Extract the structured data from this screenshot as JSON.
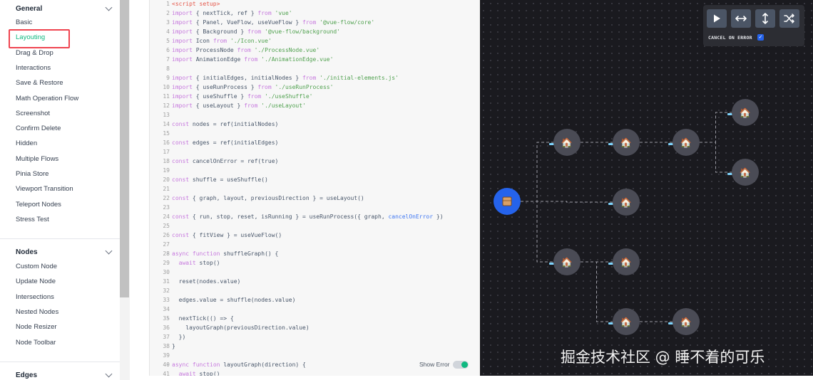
{
  "sidebar": {
    "sections": [
      {
        "title": "General",
        "items": [
          "Basic",
          "Layouting",
          "Drag & Drop",
          "Interactions",
          "Save & Restore",
          "Math Operation Flow",
          "Screenshot",
          "Confirm Delete",
          "Hidden",
          "Multiple Flows",
          "Pinia Store",
          "Viewport Transition",
          "Teleport Nodes",
          "Stress Test"
        ]
      },
      {
        "title": "Nodes",
        "items": [
          "Custom Node",
          "Update Node",
          "Intersections",
          "Nested Nodes",
          "Node Resizer",
          "Node Toolbar"
        ]
      },
      {
        "title": "Edges",
        "items": []
      }
    ],
    "active_item": "Layouting",
    "colors": {
      "active": "#10b981",
      "highlight_box": "#ef4450"
    }
  },
  "editor": {
    "line_numbers": [
      "1",
      "2",
      "3",
      "4",
      "5",
      "6",
      "7",
      "8",
      "9",
      "10",
      "11",
      "12",
      "13",
      "14",
      "15",
      "16",
      "17",
      "18",
      "19",
      "20",
      "21",
      "22",
      "23",
      "24",
      "25",
      "26",
      "27",
      "28",
      "29",
      "30",
      "31",
      "32",
      "33",
      "34",
      "35",
      "36",
      "37",
      "38",
      "39",
      "40",
      "41"
    ],
    "fold_markers": {
      "28": "⌄",
      "35": "⌄",
      "40": "⌄"
    },
    "lines": [
      "<script setup>",
      "import { nextTick, ref } from 'vue'",
      "import { Panel, VueFlow, useVueFlow } from '@vue-flow/core'",
      "import { Background } from '@vue-flow/background'",
      "import Icon from './Icon.vue'",
      "import ProcessNode from './ProcessNode.vue'",
      "import AnimationEdge from './AnimationEdge.vue'",
      "",
      "import { initialEdges, initialNodes } from './initial-elements.js'",
      "import { useRunProcess } from './useRunProcess'",
      "import { useShuffle } from './useShuffle'",
      "import { useLayout } from './useLayout'",
      "",
      "const nodes = ref(initialNodes)",
      "",
      "const edges = ref(initialEdges)",
      "",
      "const cancelOnError = ref(true)",
      "",
      "const shuffle = useShuffle()",
      "",
      "const { graph, layout, previousDirection } = useLayout()",
      "",
      "const { run, stop, reset, isRunning } = useRunProcess({ graph, cancelOnError })",
      "",
      "const { fitView } = useVueFlow()",
      "",
      "async function shuffleGraph() {",
      "  await stop()",
      "",
      "  reset(nodes.value)",
      "",
      "  edges.value = shuffle(nodes.value)",
      "",
      "  nextTick(() => {",
      "    layoutGraph(previousDirection.value)",
      "  })",
      "}",
      "",
      "async function layoutGraph(direction) {",
      "  await stop()"
    ],
    "show_error_label": "Show Error",
    "show_error_on": true
  },
  "canvas": {
    "controls": {
      "play_icon": "play-icon",
      "horizontal_icon": "arrows-horizontal-icon",
      "vertical_icon": "arrows-vertical-icon",
      "shuffle_icon": "shuffle-icon",
      "cancel_on_error_label": "CANCEL ON ERROR",
      "cancel_on_error_checked": true
    },
    "start_node_icon": "package-icon",
    "process_node_icon": "house-icon",
    "process_node_glyph": "🏠",
    "start_node_color": "#2563eb",
    "process_node_color": "#4a4b55",
    "watermark": "掘金技术社区 @ 睡不着的可乐"
  }
}
